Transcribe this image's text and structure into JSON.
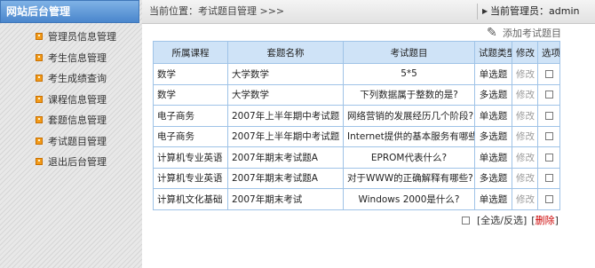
{
  "sidebar": {
    "title": "网站后台管理",
    "items": [
      {
        "label": "管理员信息管理"
      },
      {
        "label": "考生信息管理"
      },
      {
        "label": "考生成绩查询"
      },
      {
        "label": "课程信息管理"
      },
      {
        "label": "套题信息管理"
      },
      {
        "label": "考试题目管理"
      },
      {
        "label": "退出后台管理"
      }
    ]
  },
  "topbar": {
    "location": "当前位置：考试题目管理 >>>",
    "admin": "当前管理员：admin",
    "arrow": "▶"
  },
  "add_link": {
    "label": "添加考试题目",
    "icon": "✎"
  },
  "table": {
    "headers": {
      "course": "所属课程",
      "set": "套题名称",
      "question": "考试题目",
      "type": "试题类型",
      "edit": "修改",
      "select": "选项"
    },
    "rows": [
      {
        "course": "数学",
        "set": "大学数学",
        "question": "5*5",
        "type": "单选题",
        "edit": "修改"
      },
      {
        "course": "数学",
        "set": "大学数学",
        "question": "下列数据属于整数的是?",
        "type": "多选题",
        "edit": "修改"
      },
      {
        "course": "电子商务",
        "set": "2007年上半年期中考试题",
        "question": "网络营销的发展经历几个阶段?",
        "type": "单选题",
        "edit": "修改"
      },
      {
        "course": "电子商务",
        "set": "2007年上半年期中考试题",
        "question": "Internet提供的基本服务有哪些?",
        "type": "多选题",
        "edit": "修改"
      },
      {
        "course": "计算机专业英语",
        "set": "2007年期末考试题A",
        "question": "EPROM代表什么?",
        "type": "单选题",
        "edit": "修改"
      },
      {
        "course": "计算机专业英语",
        "set": "2007年期末考试题A",
        "question": "对于WWW的正确解释有哪些?",
        "type": "多选题",
        "edit": "修改"
      },
      {
        "course": "计算机文化基础",
        "set": "2007年期末考试",
        "question": "Windows 2000是什么?",
        "type": "单选题",
        "edit": "修改"
      }
    ]
  },
  "footer": {
    "select_all": "[全选/反选]",
    "delete_open": "[",
    "delete": "删除",
    "delete_close": "]"
  }
}
